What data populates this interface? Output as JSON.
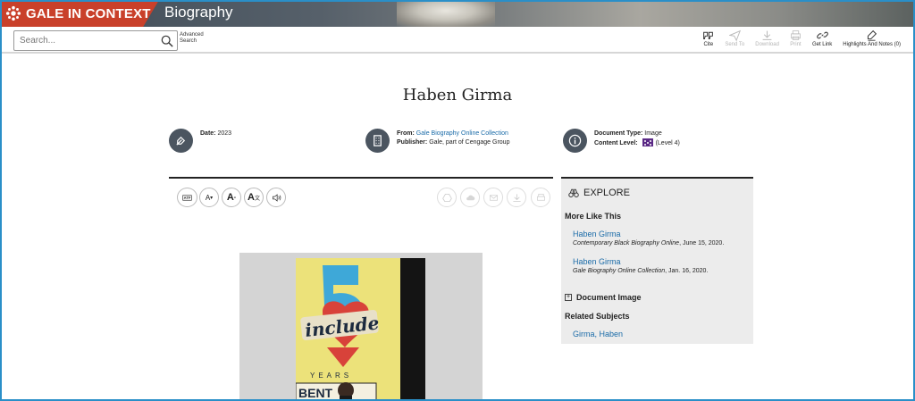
{
  "banner": {
    "brand": "GALE IN CONTEXT",
    "product": "Biography"
  },
  "toolbar": {
    "search_placeholder": "Search...",
    "advanced_search": "Advanced Search",
    "tools": [
      {
        "label": "Cite",
        "icon": "quote-icon",
        "enabled": true
      },
      {
        "label": "Send To",
        "icon": "send-icon",
        "enabled": false
      },
      {
        "label": "Download",
        "icon": "download-icon",
        "enabled": false
      },
      {
        "label": "Print",
        "icon": "print-icon",
        "enabled": false
      },
      {
        "label": "Get Link",
        "icon": "link-icon",
        "enabled": true
      },
      {
        "label": "Highlights And Notes (0)",
        "icon": "highlighter-icon",
        "enabled": true
      }
    ]
  },
  "document": {
    "title": "Haben Girma",
    "date_label": "Date:",
    "date": "2023",
    "from_label": "From:",
    "from": "Gale Biography Online Collection",
    "publisher_label": "Publisher:",
    "publisher": "Gale, part of Cengage Group",
    "doctype_label": "Document Type:",
    "doctype": "Image",
    "level_label": "Content Level:",
    "level": "(Level 4)"
  },
  "reader_tools": {
    "text_size_down": "A",
    "text_size_up": "A",
    "translate": "A"
  },
  "image": {
    "sign_text": "include",
    "sign_sub": "YEARS",
    "sign_bottom": "BENT"
  },
  "explore": {
    "heading": "EXPLORE",
    "more_like_this": "More Like This",
    "items": [
      {
        "title": "Haben Girma",
        "source": "Contemporary Black Biography Online",
        "date": ", June 15, 2020."
      },
      {
        "title": "Haben Girma",
        "source": "Gale Biography Online Collection",
        "date": ", Jan. 16, 2020."
      }
    ],
    "document_image": "Document Image",
    "related_subjects": "Related Subjects",
    "subject": "Girma, Haben"
  },
  "colors": {
    "brand": "#c9402a",
    "link": "#1a6ba8",
    "frame": "#2a8fc8",
    "level": "#5b2a86"
  }
}
